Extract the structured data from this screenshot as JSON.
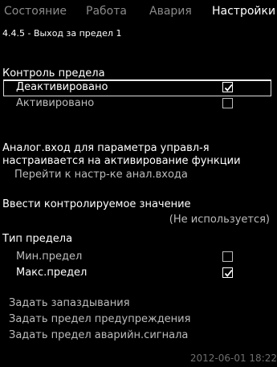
{
  "tabs": [
    {
      "label": "Состояние",
      "active": false
    },
    {
      "label": "Работа",
      "active": false
    },
    {
      "label": "Авария",
      "active": false
    },
    {
      "label": "Настройки",
      "active": true
    }
  ],
  "breadcrumb": "4.4.5 - Выход за предел 1",
  "limit_control": {
    "title": "Контроль предела",
    "options": [
      {
        "label": "Деактивировано",
        "checked": true,
        "selected": true
      },
      {
        "label": "Активировано",
        "checked": false,
        "selected": false
      }
    ]
  },
  "analog_note": {
    "line1": "Аналог.вход для параметра управл-я",
    "line2": "настраивается на активирование функции",
    "link": "Перейти к настр-ке анал.входа"
  },
  "monitored": {
    "title": "Ввести контролируемое значение",
    "value": "(Не используется)"
  },
  "limit_type": {
    "title": "Тип предела",
    "options": [
      {
        "label": "Мин.предел",
        "checked": false
      },
      {
        "label": "Макс.предел",
        "checked": true
      }
    ]
  },
  "actions": [
    "Задать запаздывания",
    "Задать предел предупреждения",
    "Задать предел аварийн.сигнала"
  ],
  "timestamp": "2012-06-01 18:22"
}
